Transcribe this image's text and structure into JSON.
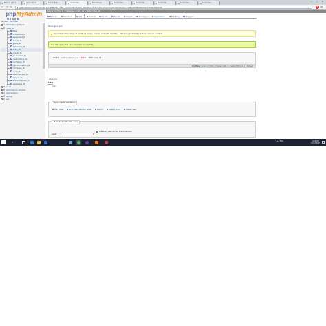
{
  "browser": {
    "tabs": [
      {
        "label": "How to get ro"
      },
      {
        "label": "java mail ai"
      },
      {
        "label": "Count #(C"
      },
      {
        "label": "localhost /"
      },
      {
        "label": "Ramada G"
      },
      {
        "label": "localhost /"
      },
      {
        "label": "localhost"
      },
      {
        "label": "localhost"
      },
      {
        "label": "localhost /"
      },
      {
        "label": "localhost /"
      }
    ],
    "url": "localhost/phpmyadmin/index.php#PMAURL-7:tbl_sql.php?db=hotels_db&table=hotel_db&server=1&target=&token=a48ec0076091b0e5e71f2a0203ef41b",
    "window_controls": {
      "minimize": "—",
      "maximize": "□",
      "close": "✕"
    }
  },
  "sidebar": {
    "logo_main": "php",
    "logo_accent": "MyAdmin",
    "tabs": [
      "Recent",
      "Favorites"
    ],
    "tree": [
      {
        "label": "information_schema",
        "kind": "db",
        "exp": "+"
      },
      {
        "label": "hotels_db",
        "kind": "db",
        "exp": "−"
      },
      {
        "label": "New",
        "kind": "table"
      },
      {
        "label": "companies_tb",
        "kind": "table"
      },
      {
        "label": "equipment_tb",
        "kind": "table"
      },
      {
        "label": "guests_tb",
        "kind": "table"
      },
      {
        "label": "guest_tb",
        "kind": "table"
      },
      {
        "label": "hotelroom_tb",
        "kind": "table"
      },
      {
        "label": "hotel_db",
        "kind": "table",
        "selected": true
      },
      {
        "label": "reader_tb",
        "kind": "table"
      },
      {
        "label": "reservation_tb",
        "kind": "table"
      },
      {
        "label": "reservations_tb",
        "kind": "table"
      },
      {
        "label": "roomitem_tb",
        "kind": "table"
      },
      {
        "label": "roomoccupancy_tb",
        "kind": "table"
      },
      {
        "label": "roomtype_tb",
        "kind": "table"
      },
      {
        "label": "room_tb",
        "kind": "table"
      },
      {
        "label": "seller/advisor_tb",
        "kind": "table"
      },
      {
        "label": "service_tb",
        "kind": "table"
      },
      {
        "label": "tempcomputer_tb",
        "kind": "table"
      },
      {
        "label": "washtable_tb",
        "kind": "table"
      },
      {
        "label": "mysql",
        "kind": "db",
        "exp": "+"
      },
      {
        "label": "performance_schema",
        "kind": "db",
        "exp": "+"
      },
      {
        "label": "phpmyadmin",
        "kind": "db",
        "exp": "+"
      },
      {
        "label": "register",
        "kind": "db",
        "exp": "+"
      },
      {
        "label": "test",
        "kind": "db",
        "exp": "+"
      }
    ]
  },
  "main": {
    "breadcrumb": {
      "server": "Server: 127.0.0.1",
      "database": "Database: hotels_db",
      "table": "Table: hotel_db"
    },
    "topmenu": [
      "Browse",
      "Structure",
      "SQL",
      "Search",
      "Insert",
      "Export",
      "Import",
      "Privileges",
      "Operations",
      "Tracking",
      "Triggers"
    ],
    "active_tab": "SQL",
    "query_caption": "Show query box",
    "warning": "Current selection does not contain a unique column. Grid edit, checkbox, Edit, Copy and Delete features are not available.",
    "success": "Your SQL query has been executed successfully.",
    "sql": {
      "kw1": "SELECT",
      "fn": "count(room_no)",
      "kw2": "as",
      "alias": "'total'",
      "kw3": "FROM",
      "table": "room_tb"
    },
    "sql_links": {
      "profiling": "Profiling",
      "links": [
        "Inline",
        "Edit",
        "Explain SQL",
        "Create PHP Code",
        "Refresh"
      ]
    },
    "options_label": "+ Options",
    "result_header": "total",
    "result_value": "NULL",
    "query_ops": {
      "legend": "Query results operations",
      "links": [
        "Print view",
        "Print view (with full texts)",
        "Export",
        "Display chart",
        "Create view"
      ]
    },
    "bookmark": {
      "legend": "Bookmark this SQL query",
      "label": "Label:",
      "checkbox_label": "Let every user access this bookmark"
    }
  },
  "taskbar": {
    "clock_time": "4:18 PM",
    "clock_date": "10/13/2015",
    "tray_text": "ENG"
  }
}
